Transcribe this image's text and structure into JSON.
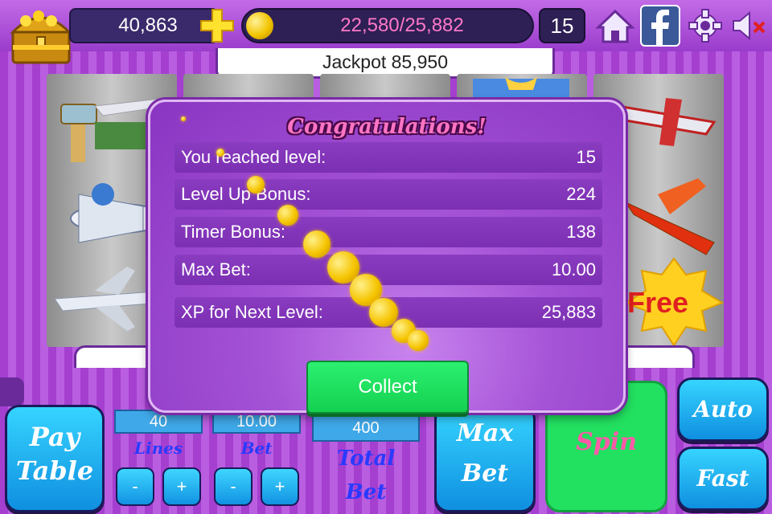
{
  "topbar": {
    "coins": "40,863",
    "xp_progress": "22,580/25,882",
    "level": "15",
    "jackpot": "Jackpot 85,950",
    "icons": [
      "treasure-chest-icon",
      "plus-icon",
      "home-icon",
      "facebook-icon",
      "gear-icon",
      "mute-icon"
    ]
  },
  "dialog": {
    "title": "Congratulations!",
    "rows": [
      {
        "label": "You reached level:",
        "value": "15"
      },
      {
        "label": "Level Up Bonus:",
        "value": "224"
      },
      {
        "label": "Timer Bonus:",
        "value": "138"
      },
      {
        "label": "Max Bet:",
        "value": "10.00"
      },
      {
        "label": "XP for Next Level:",
        "value": "25,883"
      }
    ],
    "collect_label": "Collect"
  },
  "controls": {
    "paytable_line1": "Pay",
    "paytable_line2": "Table",
    "lines_value": "40",
    "lines_label": "Lines",
    "bet_value": "10.00",
    "bet_label": "Bet",
    "total_bet_value": "400",
    "total_bet_line1": "Total",
    "total_bet_line2": "Bet",
    "minus": "-",
    "plus": "+",
    "maxbet_line1": "Max",
    "maxbet_line2": "Bet",
    "spin_label": "Spin",
    "auto_label": "Auto",
    "fast_label": "Fast"
  },
  "reels": {
    "free_symbol": "Free"
  },
  "colors": {
    "accent_purple": "#a452d6",
    "collect_green": "#22e060",
    "button_blue": "#1192e2",
    "title_pink": "#ff74c4"
  }
}
